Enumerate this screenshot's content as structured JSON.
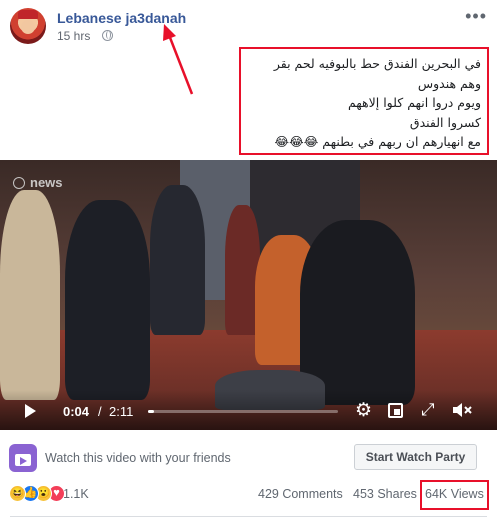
{
  "post": {
    "page_name": "Lebanese ja3danah",
    "time": "15 hrs",
    "privacy_icon": "globe-icon",
    "menu_icon": "more-horizontal-icon",
    "caption_lines": [
      "في البحرين الفندق حط بالبوفيه لحم بقر",
      "وهم هندوس",
      "ويوم دروا انهم كلوا إلاههم",
      "كسروا الفندق",
      "مع انهيارهم ان ربهم في بطنهم 😂😂😂"
    ]
  },
  "video": {
    "watermark": "news",
    "time_current": "0:04",
    "time_separator": "/",
    "time_total": "2:11",
    "progress_fraction": 0.03,
    "controls": [
      "play-icon",
      "settings-icon",
      "picture-in-picture-icon",
      "fullscreen-icon",
      "mute-icon"
    ]
  },
  "watch_party": {
    "prompt": "Watch this video with your friends",
    "button_label": "Start Watch Party"
  },
  "stats": {
    "reactions": [
      "haha",
      "like",
      "wow",
      "love"
    ],
    "reaction_count": "1.1K",
    "comments": "429 Comments",
    "shares": "453 Shares",
    "views": "64K Views"
  },
  "colors": {
    "link_blue": "#385898",
    "highlight_red": "#e8102a",
    "watch_party_purple": "#8a63d2"
  }
}
